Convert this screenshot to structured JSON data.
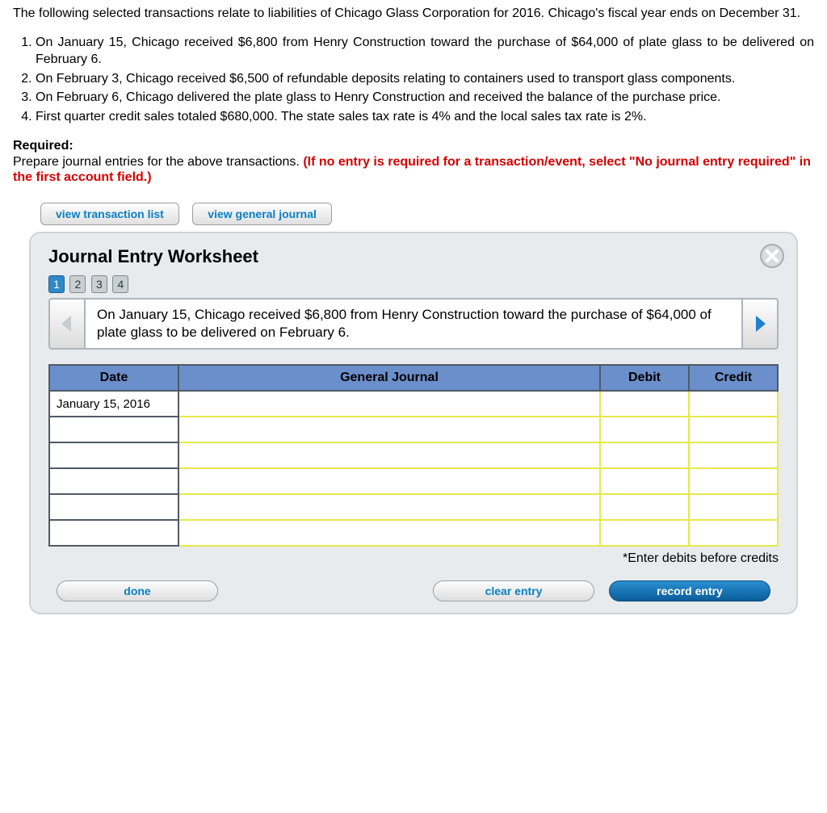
{
  "intro": "The following selected transactions relate to liabilities of Chicago Glass Corporation for 2016. Chicago's fiscal year ends on December 31.",
  "list_items": [
    "On January 15, Chicago received $6,800 from Henry Construction toward the purchase of $64,000 of plate glass to be delivered on February 6.",
    "On February 3, Chicago received $6,500 of refundable deposits relating to containers used to transport glass components.",
    "On February 6, Chicago delivered the plate glass to Henry Construction and received the balance of the purchase price.",
    "First quarter credit sales totaled $680,000. The state sales tax rate is 4% and the local sales tax rate is 2%."
  ],
  "required": {
    "label": "Required:",
    "text": "Prepare journal entries for the above transactions. ",
    "red": "(If no entry is required for a transaction/event, select \"No journal entry required\" in the first account field.)"
  },
  "buttons": {
    "view_tx": "view transaction list",
    "view_gj": "view general journal"
  },
  "worksheet": {
    "title": "Journal Entry Worksheet",
    "steps": [
      "1",
      "2",
      "3",
      "4"
    ],
    "current_step_index": 0,
    "prompt": "On January 15, Chicago received $6,800 from Henry Construction toward the purchase of $64,000 of plate glass to be delivered on February 6.",
    "table": {
      "headers": {
        "date": "Date",
        "gj": "General Journal",
        "debit": "Debit",
        "credit": "Credit"
      },
      "rows": [
        {
          "date": "January 15, 2016",
          "gj": "",
          "debit": "",
          "credit": ""
        },
        {
          "date": "",
          "gj": "",
          "debit": "",
          "credit": ""
        },
        {
          "date": "",
          "gj": "",
          "debit": "",
          "credit": ""
        },
        {
          "date": "",
          "gj": "",
          "debit": "",
          "credit": ""
        },
        {
          "date": "",
          "gj": "",
          "debit": "",
          "credit": ""
        },
        {
          "date": "",
          "gj": "",
          "debit": "",
          "credit": ""
        }
      ],
      "footnote": "*Enter debits before credits"
    },
    "actions": {
      "done": "done",
      "clear": "clear entry",
      "record": "record entry"
    }
  }
}
